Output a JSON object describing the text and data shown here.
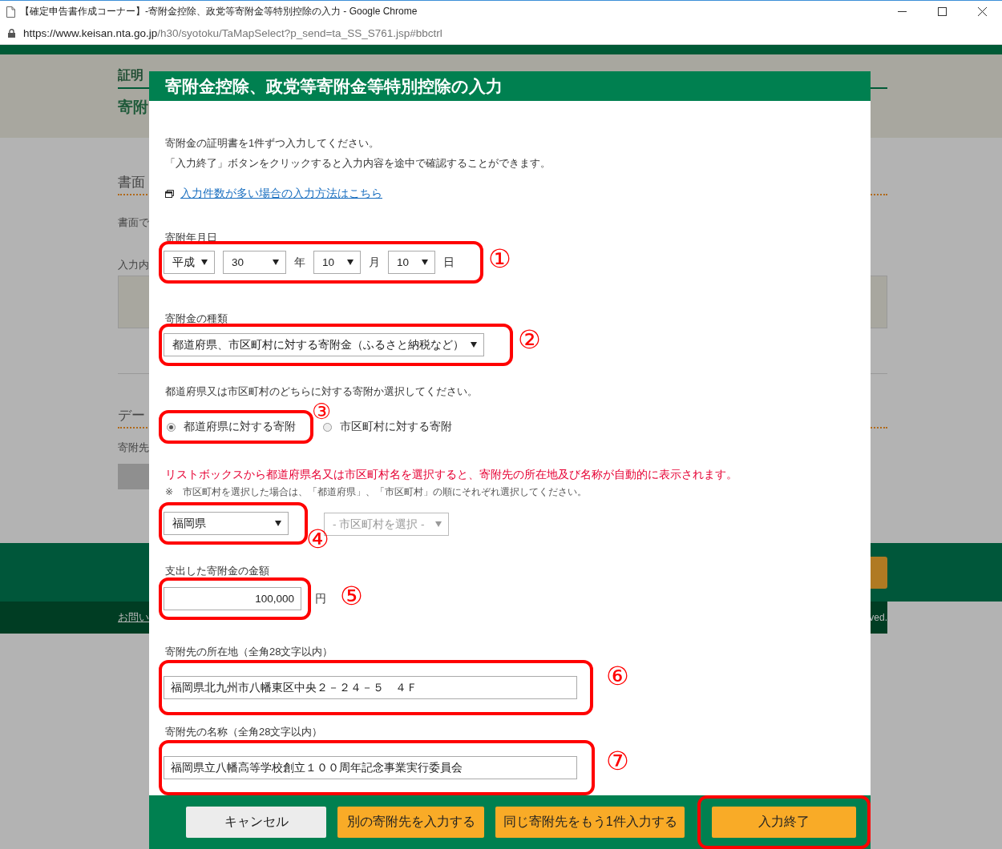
{
  "browser": {
    "title": "【確定申告書作成コーナー】-寄附金控除、政党等寄附金等特別控除の入力 - Google Chrome",
    "url_host": "https://www.keisan.nta.go.jp",
    "url_path": "/h30/syotoku/TaMapSelect?p_send=ta_SS_S761.jsp#bbctrl"
  },
  "background_page": {
    "breadcrumb": "証明",
    "page_title": "寄附",
    "section_1_heading": "書面",
    "section_1_text": "書面で",
    "section_1_label": "入力内",
    "section_2_heading": "デー",
    "section_2_label": "寄附先",
    "footer_link": "お問い",
    "copyright": "ved."
  },
  "dialog": {
    "title": "寄附金控除、政党等寄附金等特別控除の入力",
    "intro": [
      "寄附金の証明書を1件ずつ入力してください。",
      "「入力終了」ボタンをクリックすると入力内容を途中で確認することができます。"
    ],
    "link": "入力件数が多い場合の入力方法はこちら",
    "date": {
      "label": "寄附年月日",
      "marker": "①",
      "era": "平成",
      "year": "30",
      "year_unit": "年",
      "month": "10",
      "month_unit": "月",
      "day": "10",
      "day_unit": "日"
    },
    "type": {
      "label": "寄附金の種類",
      "marker": "②",
      "value": "都道府県、市区町村に対する寄附金（ふるさと納税など）"
    },
    "target": {
      "question": "都道府県又は市区町村のどちらに対する寄附か選択してください。",
      "marker": "③",
      "options": [
        {
          "label": "都道府県に対する寄附",
          "selected": true
        },
        {
          "label": "市区町村に対する寄附",
          "selected": false
        }
      ]
    },
    "notice": "リストボックスから都道府県名又は市区町村名を選択すると、寄附先の所在地及び名称が自動的に表示されます。",
    "note": "※　市区町村を選択した場合は、「都道府県」、「市区町村」の順にそれぞれ選択してください。",
    "prefecture": {
      "marker": "④",
      "value": "福岡県",
      "disabled": false
    },
    "city": {
      "placeholder": "- 市区町村を選択 -",
      "disabled": true
    },
    "amount": {
      "label": "支出した寄附金の金額",
      "marker": "⑤",
      "value": "100,000",
      "unit": "円"
    },
    "address": {
      "label": "寄附先の所在地（全角28文字以内）",
      "marker": "⑥",
      "value": "福岡県北九州市八幡東区中央２－２４－５　４Ｆ"
    },
    "name": {
      "label": "寄附先の名称（全角28文字以内）",
      "marker": "⑦",
      "value": "福岡県立八幡高等学校創立１００周年記念事業実行委員会"
    },
    "buttons": [
      {
        "label": "キャンセル",
        "kind": "plain",
        "highlighted": false
      },
      {
        "label": "別の寄附先を入力する",
        "kind": "accent",
        "highlighted": false
      },
      {
        "label": "同じ寄附先をもう1件入力する",
        "kind": "accent",
        "highlighted": false
      },
      {
        "label": "入力終了",
        "kind": "accent",
        "highlighted": true
      }
    ]
  }
}
